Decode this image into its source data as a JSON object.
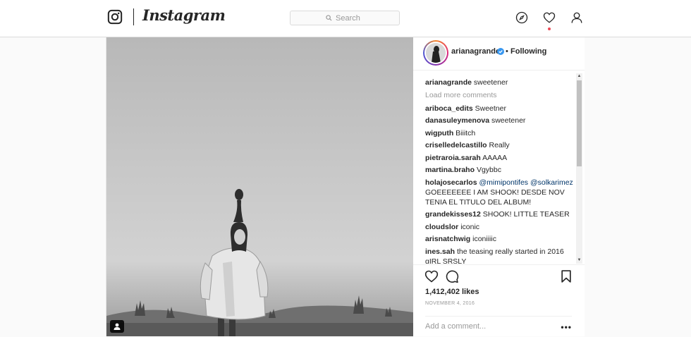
{
  "nav": {
    "wordmark": "Instagram",
    "search_placeholder": "Search",
    "icons": [
      "instagram-camera-icon",
      "compass-icon",
      "heart-icon",
      "profile-icon"
    ],
    "notification_dot_color": "#ed4956"
  },
  "post": {
    "header": {
      "username": "arianagrande",
      "separator": "•",
      "follow_status": "Following",
      "verified_color": "#3897f0"
    },
    "caption": {
      "user": "arianagrande",
      "text": "sweetener"
    },
    "load_more": "Load more comments",
    "comments": [
      {
        "user": "ariboca_edits",
        "text": "Sweetner"
      },
      {
        "user": "danasuleymenova",
        "text": "sweetener"
      },
      {
        "user": "wigputh",
        "text": "Biiitch"
      },
      {
        "user": "criselledelcastillo",
        "text": "Really"
      },
      {
        "user": "pietraroia.sarah",
        "text": "AAAAA"
      },
      {
        "user": "martina.braho",
        "text": "Vgybbc"
      },
      {
        "user": "holajosecarlos",
        "mention1": "@mimipontifes",
        "mention2": "@solkarimez",
        "text": "GOEEEEEEE I AM SHOOK! DESDE NOV TENIA EL TITULO DEL ALBUM!"
      },
      {
        "user": "grandekisses12",
        "text": "SHOOK! LITTLE TEASER"
      },
      {
        "user": "cloudslor",
        "text": "iconic"
      },
      {
        "user": "arisnatchwig",
        "text": "iconiiiic"
      },
      {
        "user": "ines.sah",
        "text": "the teasing really started in 2016 gIRL SRSLY"
      }
    ],
    "likes": "1,412,402 likes",
    "date": "NOVEMBER 4, 2016",
    "add_comment_placeholder": "Add a comment...",
    "more_label": "•••"
  }
}
